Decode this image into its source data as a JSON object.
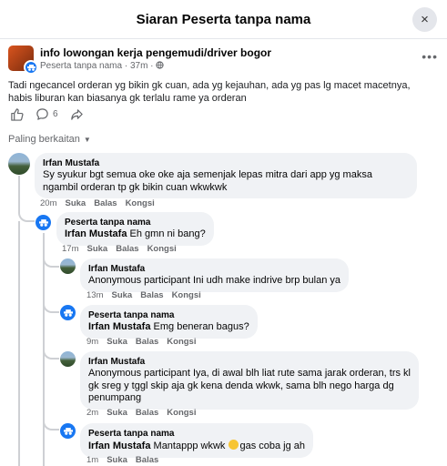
{
  "dialog": {
    "title": "Siaran Peserta tanpa nama",
    "close_icon": "×"
  },
  "post": {
    "group_name": "info lowongan kerja pengemudi/driver bogor",
    "author": "Peserta tanpa nama",
    "time": "37m",
    "privacy_icon": "globe-icon",
    "text": "Tadi ngecancel orderan yg bikin gk cuan, ada yg kejauhan, ada yg pas lg macet macetnya, habis liburan kan biasanya gk terlalu rame ya orderan",
    "comment_count": "6",
    "more": "•••"
  },
  "sort_label": "Paling berkaitan",
  "comments": [
    {
      "author": "Irfan Mustafa",
      "mention": "",
      "text": "Sy syukur bgt semua oke oke aja semenjak lepas mitra dari app yg maksa ngambil orderan tp gk bikin cuan wkwkwk",
      "time": "20m",
      "like": "Suka",
      "reply": "Balas",
      "share": "Kongsi"
    },
    {
      "author": "Peserta tanpa nama",
      "mention": "Irfan Mustafa",
      "text": " Eh gmn ni bang?",
      "time": "17m",
      "like": "Suka",
      "reply": "Balas",
      "share": "Kongsi"
    },
    {
      "author": "Irfan Mustafa",
      "mention": "",
      "text": "Anonymous participant Ini udh make indrive brp bulan ya",
      "time": "13m",
      "like": "Suka",
      "reply": "Balas",
      "share": "Kongsi"
    },
    {
      "author": "Peserta tanpa nama",
      "mention": "Irfan Mustafa",
      "text": " Emg beneran bagus?",
      "time": "9m",
      "like": "Suka",
      "reply": "Balas",
      "share": "Kongsi"
    },
    {
      "author": "Irfan Mustafa",
      "mention": "",
      "text": "Anonymous participant Iya, di awal blh liat rute sama jarak orderan, trs kl gk sreg y tggl skip aja gk kena denda wkwk, sama blh nego harga dg penumpang",
      "time": "2m",
      "like": "Suka",
      "reply": "Balas",
      "share": "Kongsi"
    },
    {
      "author": "Peserta tanpa nama",
      "mention": "Irfan Mustafa",
      "text_before": " Mantappp wkwk ",
      "text_after": "gas coba jg ah",
      "time": "1m",
      "like": "Suka",
      "reply": "Balas"
    }
  ],
  "colors": {
    "accent": "#1877f2",
    "bubble": "#f0f2f5",
    "meta": "#65676b"
  }
}
